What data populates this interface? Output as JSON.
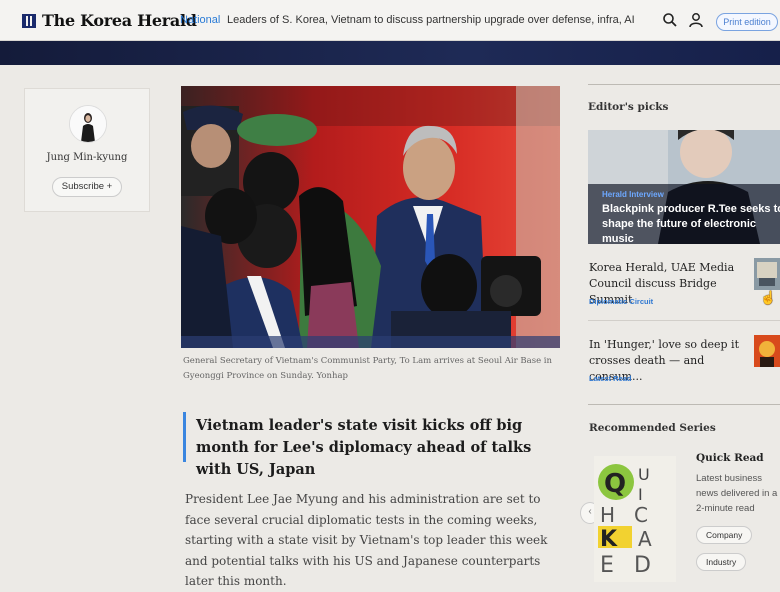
{
  "header": {
    "logo_text": "The Korea Herald",
    "section_label": "National",
    "ticker_headline": "Leaders of S. Korea, Vietnam to discuss partnership upgrade over defense, infra, AI",
    "print_edition_label": "Print edition",
    "icons": [
      "search-icon",
      "user-icon"
    ]
  },
  "author": {
    "name": "Jung Min-kyung",
    "subscribe_label": "Subscribe +"
  },
  "article": {
    "caption": "General Secretary of Vietnam's Communist Party, To Lam arrives at Seoul Air Base in Gyeonggi Province on Sunday. Yonhap",
    "title": "Vietnam leader's state visit kicks off big month for Lee's diplomacy ahead of talks with US, Japan",
    "lead": "President Lee Jae Myung and his administration are set to face several crucial diplomatic tests in the coming weeks, starting with a state visit by Vietnam's top leader this week and potential talks with his US and Japanese counterparts later this month."
  },
  "editors_picks": {
    "heading": "Editor's picks",
    "featured": {
      "tag": "Herald Interview",
      "title": "Blackpink producer R.Tee seeks to shape the future of electronic music"
    },
    "items": [
      {
        "title": "Korea Herald, UAE Media Council discuss Bridge Summit",
        "tag": "Diplomatic Circuit"
      },
      {
        "title": "In 'Hunger,' love so deep it crosses death — and consum...",
        "tag": "Latest Read"
      }
    ]
  },
  "recommended": {
    "heading": "Recommended Series",
    "series_title": "Quick Read",
    "series_description": "Latest business news delivered in a 2-minute read",
    "chips": [
      "Company",
      "Industry"
    ],
    "cover_letters": "QUICK READ"
  },
  "colors": {
    "accent_blue": "#2f78d2",
    "navy_band": "#1a2350",
    "title_bar": "#3a86e0"
  }
}
